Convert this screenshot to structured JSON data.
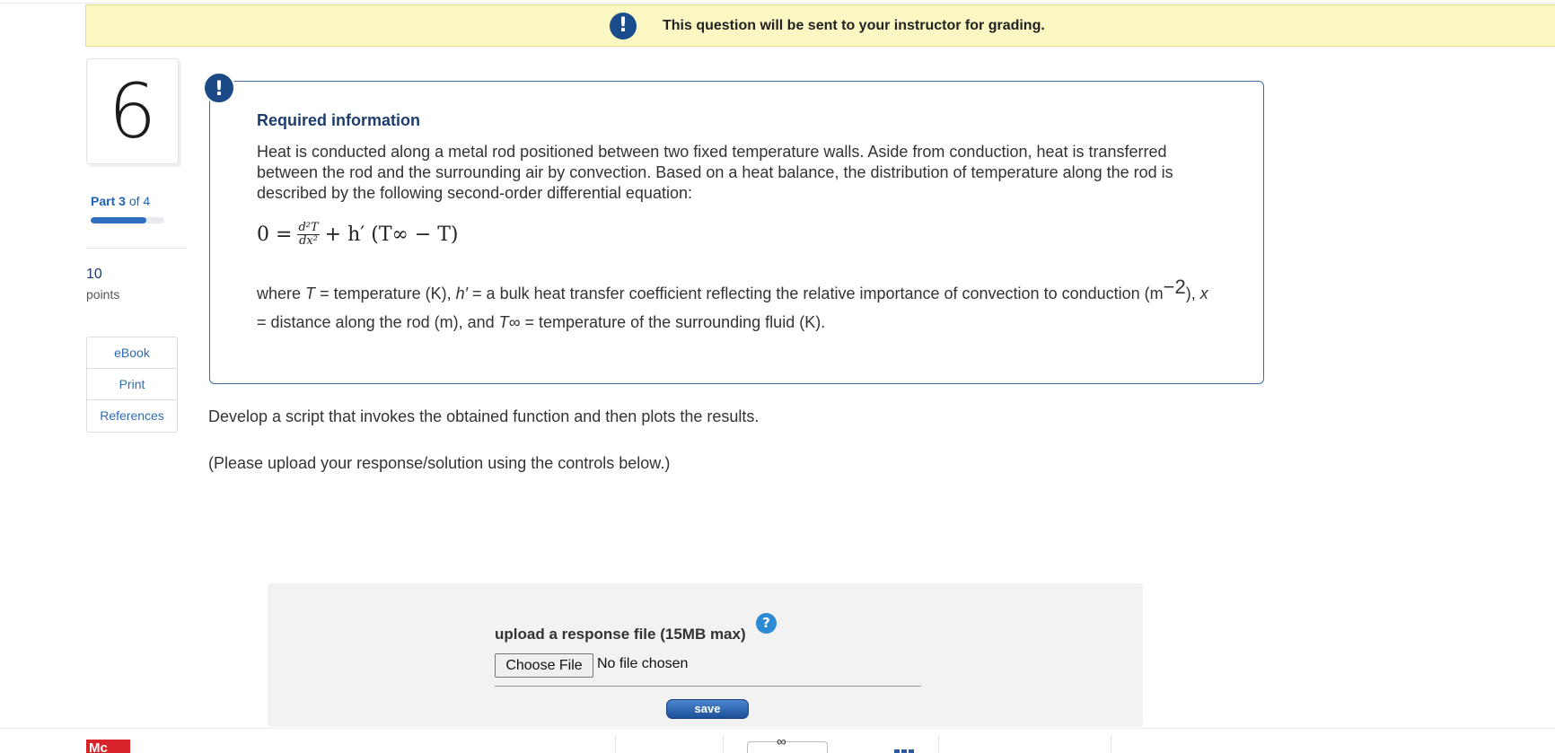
{
  "banner": {
    "icon": "exclamation-icon",
    "text": "This question will be sent to your instructor for grading."
  },
  "sidebar": {
    "question_number": "6",
    "part_label": "Part",
    "part_current": "3",
    "part_of": "of 4",
    "part_progress": 0.75,
    "points_value": "10",
    "points_label": "points",
    "links": [
      "eBook",
      "Print",
      "References"
    ]
  },
  "info": {
    "badge": "!",
    "title": "Required information",
    "paragraph": "Heat is conducted along a metal rod positioned between two fixed temperature walls. Aside from conduction, heat is transferred between the rod and the surrounding air by convection. Based on a heat balance, the distribution of temperature along the rod is described by the following second-order differential equation:",
    "equation": {
      "lhs": "0 =",
      "frac_num": "d²T",
      "frac_den": "dx²",
      "rhs": "+ h′ (T∞ − T)"
    },
    "def_where": "where",
    "def_T": "T",
    "def_T_text": "= temperature (K),",
    "def_h": "h′",
    "def_h_text": "= a bulk heat transfer coefficient reflecting the relative importance of convection to conduction (m",
    "def_exp": "−2",
    "def_x_pre": "),",
    "def_x": "x",
    "def_x_text": "= distance along the rod (m), and",
    "def_Tinf": "T∞",
    "def_Tinf_text": "= temperature of the surrounding fluid (K)."
  },
  "prompt": {
    "line1": "Develop a script that invokes the obtained function and then plots the results.",
    "line2": "(Please upload your response/solution using the controls below.)"
  },
  "upload": {
    "label": "upload a response file (15MB max)",
    "help": "?",
    "choose_button": "Choose File",
    "no_file": "No file chosen",
    "save_button": "save"
  },
  "footer": {
    "logo_text": "Mc"
  },
  "colors": {
    "banner_bg": "#fbf7c3",
    "accent_blue": "#1b4a86",
    "link_blue": "#2d6cb5",
    "brand_red": "#d6242a"
  }
}
